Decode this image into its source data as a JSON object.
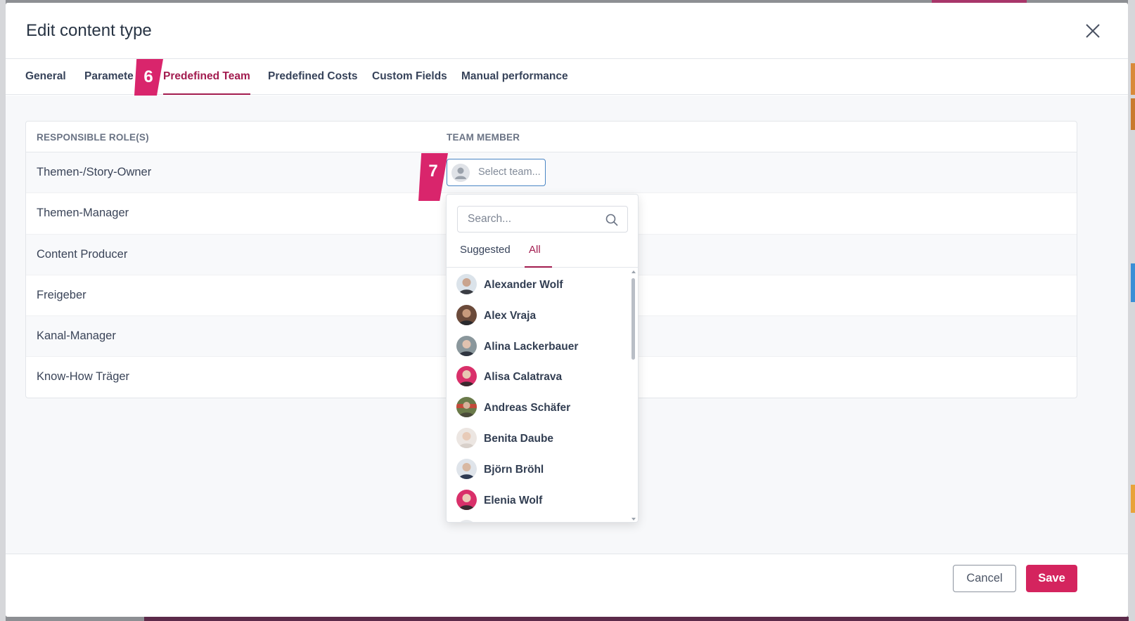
{
  "modal": {
    "title": "Edit content type"
  },
  "tabs": [
    {
      "label": "General"
    },
    {
      "label": "Paramete"
    },
    {
      "label": "Predefined Team"
    },
    {
      "label": "Predefined Costs"
    },
    {
      "label": "Custom Fields"
    },
    {
      "label": "Manual performance"
    }
  ],
  "step_badges": {
    "tab_step": "6",
    "select_step": "7"
  },
  "table": {
    "headers": {
      "roles": "RESPONSIBLE ROLE(S)",
      "member": "TEAM MEMBER"
    },
    "rows": [
      {
        "role": "Themen-/Story-Owner"
      },
      {
        "role": "Themen-Manager"
      },
      {
        "role": "Content Producer"
      },
      {
        "role": "Freigeber"
      },
      {
        "role": "Kanal-Manager"
      },
      {
        "role": "Know-How Träger"
      }
    ],
    "member_select_placeholder": "Select team..."
  },
  "dropdown": {
    "search_placeholder": "Search...",
    "tabs": {
      "suggested": "Suggested",
      "all": "All"
    },
    "people": [
      {
        "name": "Alexander Wolf",
        "avatar": "#8a8f96"
      },
      {
        "name": "Alex Vraja",
        "avatar": "#6b4a3a"
      },
      {
        "name": "Alina Lackerbauer",
        "avatar": "#7c8a90"
      },
      {
        "name": "Alisa Calatrava",
        "avatar": "#d9306a"
      },
      {
        "name": "Andreas Schäfer",
        "avatar": "#6a7a4a"
      },
      {
        "name": "Benita Daube",
        "avatar": "#d8cdc6"
      },
      {
        "name": "Björn Bröhl",
        "avatar": "#c5cad2"
      },
      {
        "name": "Elenia Wolf",
        "avatar": "#d9306a"
      },
      {
        "name": "",
        "avatar": "#9aa0a8"
      }
    ]
  },
  "footer": {
    "cancel": "Cancel",
    "save": "Save"
  },
  "colors": {
    "accent": "#a21c4f",
    "primary_button": "#d4245e",
    "badge": "#d9256c",
    "focus": "#4a86c4"
  }
}
